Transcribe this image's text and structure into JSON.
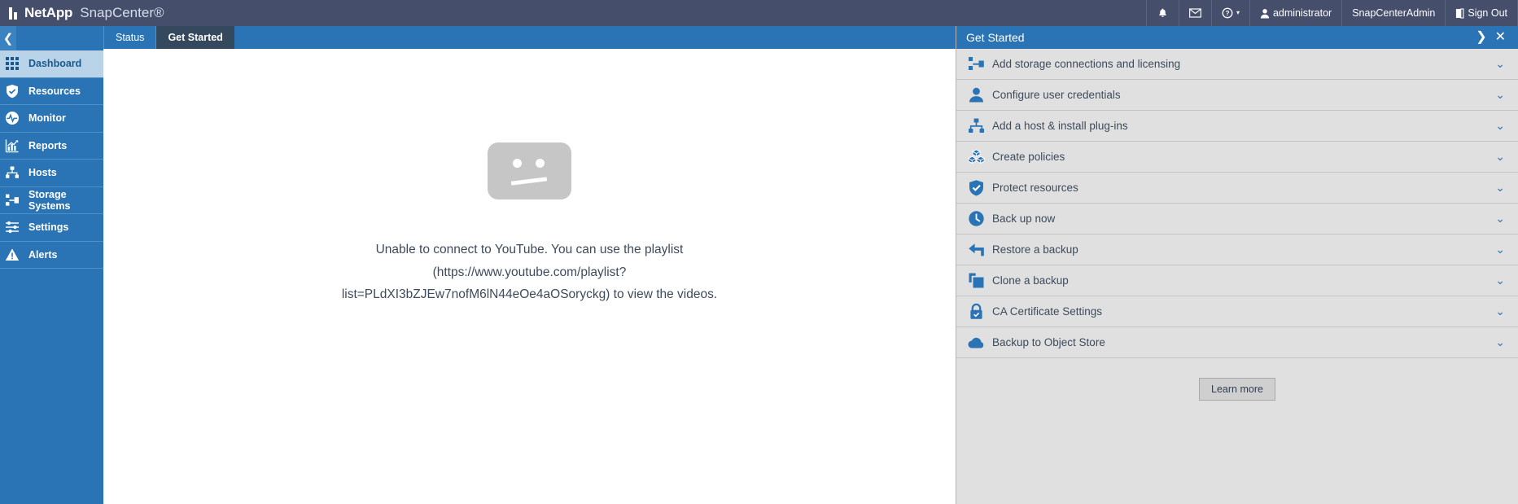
{
  "header": {
    "brand_mark": "netapp-logo",
    "brand": "NetApp",
    "product": "SnapCenter®",
    "items": [
      {
        "icon": "bell-icon",
        "glyph": "🔔",
        "label": ""
      },
      {
        "icon": "envelope-icon",
        "glyph": "✉",
        "label": ""
      },
      {
        "icon": "help-icon",
        "glyph": "❓",
        "label": "▾"
      }
    ],
    "user_icon": "user-icon",
    "user": "administrator",
    "role": "SnapCenterAdmin",
    "signout_icon": "signout-icon",
    "signout": "Sign Out"
  },
  "sidebar": {
    "collapse_icon": "chevron-left-icon",
    "items": [
      {
        "label": "Dashboard",
        "icon": "grid-icon",
        "active": true
      },
      {
        "label": "Resources",
        "icon": "shield-icon",
        "active": false
      },
      {
        "label": "Monitor",
        "icon": "pulse-icon",
        "active": false
      },
      {
        "label": "Reports",
        "icon": "chart-icon",
        "active": false
      },
      {
        "label": "Hosts",
        "icon": "hosts-icon",
        "active": false
      },
      {
        "label": "Storage Systems",
        "icon": "storage-icon",
        "active": false
      },
      {
        "label": "Settings",
        "icon": "sliders-icon",
        "active": false
      },
      {
        "label": "Alerts",
        "icon": "warning-icon",
        "active": false
      }
    ]
  },
  "tabs": [
    {
      "label": "Status",
      "active": false
    },
    {
      "label": "Get Started",
      "active": true
    }
  ],
  "main": {
    "icon": "sad-face-icon",
    "message_line1": "Unable to connect to YouTube. You can use the playlist",
    "message_line2": "(https://www.youtube.com/playlist?",
    "message_line3": "list=PLdXI3bZJEw7nofM6lN44eOe4aOSoryckg) to view the videos."
  },
  "right_panel": {
    "title": "Get Started",
    "expand_icon": "chevron-right-icon",
    "expand_glyph": "❯",
    "close_icon": "close-icon",
    "close_glyph": "✕",
    "chevron_glyph": "⌄",
    "items": [
      {
        "label": "Add storage connections and licensing",
        "icon": "storage-icon"
      },
      {
        "label": "Configure user credentials",
        "icon": "user-icon"
      },
      {
        "label": "Add a host & install plug-ins",
        "icon": "hosts-icon"
      },
      {
        "label": "Create policies",
        "icon": "boxes-icon"
      },
      {
        "label": "Protect resources",
        "icon": "shield-check-icon"
      },
      {
        "label": "Back up now",
        "icon": "clock-icon"
      },
      {
        "label": "Restore a backup",
        "icon": "undo-arrow-icon"
      },
      {
        "label": "Clone a backup",
        "icon": "copy-icon"
      },
      {
        "label": "CA Certificate Settings",
        "icon": "lock-icon"
      },
      {
        "label": "Backup to Object Store",
        "icon": "cloud-icon"
      }
    ],
    "learn_more": "Learn more"
  },
  "colors": {
    "header_bg": "#454f6b",
    "accent_blue": "#2a74b5",
    "panel_bg": "#e0e0e0",
    "active_tab_bg": "#34495e"
  }
}
